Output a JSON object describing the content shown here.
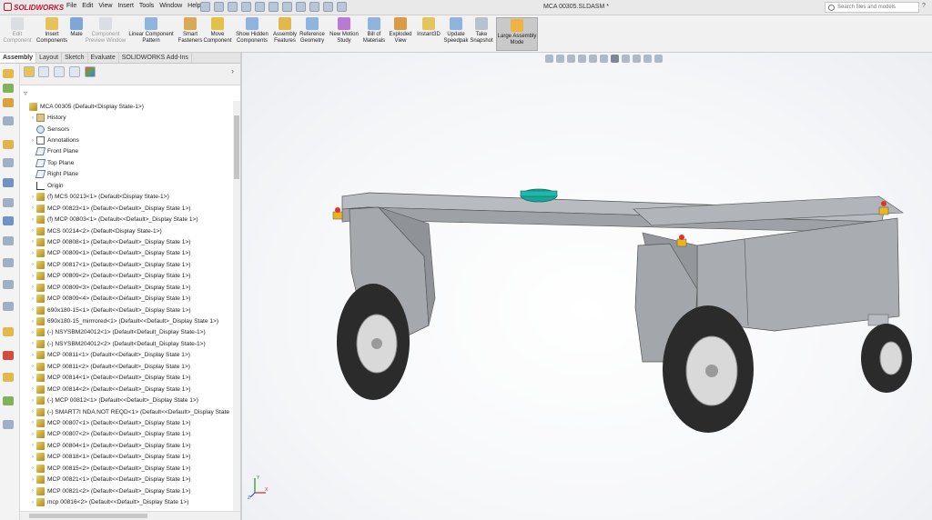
{
  "app": {
    "logo": "SOLIDWORKS",
    "document_title": "MCA 00305.SLDASM *"
  },
  "menu": [
    "File",
    "Edit",
    "View",
    "Insert",
    "Tools",
    "Window",
    "Help"
  ],
  "search": {
    "placeholder": "Search files and models",
    "help": "?"
  },
  "commands": [
    {
      "label": "Edit\nComponent",
      "icon": "edit-component-icon",
      "disabled": true
    },
    {
      "label": "Insert\nComponents",
      "icon": "insert-components-icon"
    },
    {
      "label": "Mate",
      "icon": "mate-icon"
    },
    {
      "label": "Component\nPreview Window",
      "icon": "preview-window-icon",
      "disabled": true
    },
    {
      "label": "Linear Component\nPattern",
      "icon": "linear-pattern-icon"
    },
    {
      "label": "Smart\nFasteners",
      "icon": "smart-fasteners-icon"
    },
    {
      "label": "Move\nComponent",
      "icon": "move-component-icon"
    },
    {
      "label": "Show Hidden\nComponents",
      "icon": "show-hidden-icon"
    },
    {
      "label": "Assembly\nFeatures",
      "icon": "assembly-features-icon"
    },
    {
      "label": "Reference\nGeometry",
      "icon": "reference-geometry-icon"
    },
    {
      "label": "New Motion\nStudy",
      "icon": "motion-study-icon"
    },
    {
      "label": "Bill of\nMaterials",
      "icon": "bom-icon"
    },
    {
      "label": "Exploded\nView",
      "icon": "exploded-view-icon"
    },
    {
      "label": "Instant3D",
      "icon": "instant3d-icon"
    },
    {
      "label": "Update\nSpeedpak",
      "icon": "speedpak-icon"
    },
    {
      "label": "Take\nSnapshot",
      "icon": "snapshot-icon"
    },
    {
      "label": "Large Assembly\nMode",
      "icon": "large-assembly-icon",
      "active": true
    }
  ],
  "tabs": [
    "Assembly",
    "Layout",
    "Sketch",
    "Evaluate",
    "SOLIDWORKS Add-Ins"
  ],
  "tree": [
    {
      "label": "MCA 00305  (Default<Display State-1>)",
      "icon": "assembly",
      "expander": "",
      "indent": 0
    },
    {
      "label": "History",
      "icon": "folder",
      "expander": "›",
      "indent": 1
    },
    {
      "label": "Sensors",
      "icon": "sensor",
      "expander": "",
      "indent": 1
    },
    {
      "label": "Annotations",
      "icon": "annot",
      "expander": "›",
      "indent": 1
    },
    {
      "label": "Front Plane",
      "icon": "plane",
      "expander": "",
      "indent": 1
    },
    {
      "label": "Top Plane",
      "icon": "plane",
      "expander": "",
      "indent": 1
    },
    {
      "label": "Right Plane",
      "icon": "plane",
      "expander": "",
      "indent": 1
    },
    {
      "label": "Origin",
      "icon": "origin",
      "expander": "",
      "indent": 1
    },
    {
      "label": "(f) MCS 00213<1> (Default<Display State-1>)",
      "icon": "part",
      "expander": "›",
      "indent": 1
    },
    {
      "label": "MCP 00823<1> (Default<<Default>_Display State 1>)",
      "icon": "part",
      "expander": "›",
      "indent": 1
    },
    {
      "label": "(f) MCP 00803<1> (Default<<Default>_Display State 1>)",
      "icon": "part",
      "expander": "›",
      "indent": 1
    },
    {
      "label": "MCS 00214<2> (Default<Display State-1>)",
      "icon": "part",
      "expander": "›",
      "indent": 1
    },
    {
      "label": "MCP 00808<1> (Default<<Default>_Display State 1>)",
      "icon": "part",
      "expander": "›",
      "indent": 1
    },
    {
      "label": "MCP 00809<1> (Default<<Default>_Display State 1>)",
      "icon": "part",
      "expander": "›",
      "indent": 1
    },
    {
      "label": "MCP 00817<1> (Default<<Default>_Display State 1>)",
      "icon": "part",
      "expander": "›",
      "indent": 1
    },
    {
      "label": "MCP 00809<2> (Default<<Default>_Display State 1>)",
      "icon": "part",
      "expander": "›",
      "indent": 1
    },
    {
      "label": "MCP 00809<3> (Default<<Default>_Display State 1>)",
      "icon": "part",
      "expander": "›",
      "indent": 1
    },
    {
      "label": "MCP 00809<4> (Default<<Default>_Display State 1>)",
      "icon": "part",
      "expander": "›",
      "indent": 1
    },
    {
      "label": "690x180-15<1> (Default<<Default>_Display State 1>)",
      "icon": "part",
      "expander": "›",
      "indent": 1
    },
    {
      "label": "690x180-15_mirrrored<1> (Default<<Default>_Display State 1>)",
      "icon": "part",
      "expander": "›",
      "indent": 1
    },
    {
      "label": "(-) NSYSBM204012<1> (Default<Default_Display State-1>)",
      "icon": "part",
      "expander": "›",
      "indent": 1
    },
    {
      "label": "(-) NSYSBM204012<2> (Default<Default_Display State-1>)",
      "icon": "part",
      "expander": "›",
      "indent": 1
    },
    {
      "label": "MCP 00811<1> (Default<<Default>_Display State 1>)",
      "icon": "part",
      "expander": "›",
      "indent": 1
    },
    {
      "label": "MCP 00811<2> (Default<<Default>_Display State 1>)",
      "icon": "part",
      "expander": "›",
      "indent": 1
    },
    {
      "label": "MCP 00814<1> (Default<<Default>_Display State 1>)",
      "icon": "part",
      "expander": "›",
      "indent": 1
    },
    {
      "label": "MCP 00814<2> (Default<<Default>_Display State 1>)",
      "icon": "part",
      "expander": "›",
      "indent": 1
    },
    {
      "label": "(-) MCP 00812<1> (Default<<Default>_Display State 1>)",
      "icon": "part",
      "expander": "›",
      "indent": 1
    },
    {
      "label": "(-) SMART7I NDA NOT REQD<1> (Default<<Default>_Display State",
      "icon": "part",
      "expander": "›",
      "indent": 1
    },
    {
      "label": "MCP 00807<1> (Default<<Default>_Display State 1>)",
      "icon": "part",
      "expander": "›",
      "indent": 1
    },
    {
      "label": "MCP 00807<2> (Default<<Default>_Display State 1>)",
      "icon": "part",
      "expander": "›",
      "indent": 1
    },
    {
      "label": "MCP 00804<1> (Default<<Default>_Display State 1>)",
      "icon": "part",
      "expander": "›",
      "indent": 1
    },
    {
      "label": "MCP 00818<1> (Default<<Default>_Display State 1>)",
      "icon": "part",
      "expander": "›",
      "indent": 1
    },
    {
      "label": "MCP 00815<2> (Default<<Default>_Display State 1>)",
      "icon": "part",
      "expander": "›",
      "indent": 1
    },
    {
      "label": "MCP 00821<1> (Default<<Default>_Display State 1>)",
      "icon": "part",
      "expander": "›",
      "indent": 1
    },
    {
      "label": "MCP 00821<2> (Default<<Default>_Display State 1>)",
      "icon": "part",
      "expander": "›",
      "indent": 1
    },
    {
      "label": "mcp 00816<2> (Default<<Default>_Display State 1>)",
      "icon": "part",
      "expander": "›",
      "indent": 1
    }
  ],
  "triad": {
    "y": "Y",
    "x": "X",
    "z": "Z"
  },
  "colors": {
    "brand": "#c8102e",
    "frame": "#a9acb0",
    "tire": "#2b2b2b",
    "rim": "#d9d9d9",
    "cap": "#1aa59a"
  }
}
